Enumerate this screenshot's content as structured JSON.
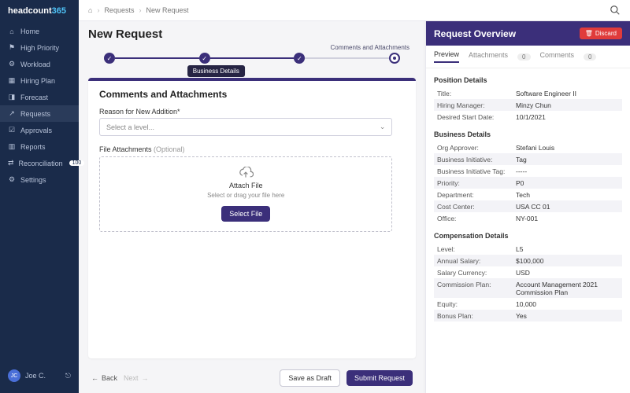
{
  "brand": {
    "a": "headcount",
    "b": "365"
  },
  "sidebar": {
    "items": [
      {
        "label": "Home"
      },
      {
        "label": "High Priority"
      },
      {
        "label": "Workload"
      },
      {
        "label": "Hiring Plan"
      },
      {
        "label": "Forecast"
      },
      {
        "label": "Requests"
      },
      {
        "label": "Approvals"
      },
      {
        "label": "Reports"
      },
      {
        "label": "Reconciliation",
        "badge": "100"
      },
      {
        "label": "Settings"
      }
    ],
    "user": {
      "initials": "JC",
      "name": "Joe C."
    }
  },
  "breadcrumbs": [
    "Requests",
    "New Request"
  ],
  "page_title": "New Request",
  "stepper": {
    "caption": "Comments and Attachments",
    "tooltip": "Business Details"
  },
  "card": {
    "title": "Comments and Attachments",
    "reason_label": "Reason for New Addition*",
    "select_placeholder": "Select a level...",
    "file_label": "File Attachments ",
    "file_optional": "(Optional)",
    "dz_title": "Attach File",
    "dz_sub": "Select or drag your file here",
    "select_file": "Select File"
  },
  "footer": {
    "back": "Back",
    "next": "Next",
    "draft": "Save as Draft",
    "submit": "Submit Request"
  },
  "panel": {
    "title": "Request Overview",
    "discard": "Discard",
    "tabs": {
      "preview": "Preview",
      "attachments": "Attachments",
      "a_count": "0",
      "comments": "Comments",
      "c_count": "0"
    },
    "sections": [
      {
        "title": "Position Details",
        "rows": [
          {
            "k": "Title:",
            "v": "Software Engineer II"
          },
          {
            "k": "Hiring Manager:",
            "v": "Minzy Chun"
          },
          {
            "k": "Desired Start Date:",
            "v": "10/1/2021"
          }
        ]
      },
      {
        "title": "Business Details",
        "rows": [
          {
            "k": "Org Approver:",
            "v": "Stefani Louis"
          },
          {
            "k": "Business Initiative:",
            "v": "Tag"
          },
          {
            "k": "Business Initiative Tag:",
            "v": "-----"
          },
          {
            "k": "Priority:",
            "v": "P0"
          },
          {
            "k": "Department:",
            "v": "Tech"
          },
          {
            "k": "Cost Center:",
            "v": "USA CC 01"
          },
          {
            "k": "Office:",
            "v": "NY-001"
          }
        ]
      },
      {
        "title": "Compensation Details",
        "rows": [
          {
            "k": "Level:",
            "v": "L5"
          },
          {
            "k": "Annual Salary:",
            "v": "$100,000"
          },
          {
            "k": "Salary Currency:",
            "v": "USD"
          },
          {
            "k": "Commission Plan:",
            "v": "Account Management 2021 Commission Plan"
          },
          {
            "k": "Equity:",
            "v": "10,000"
          },
          {
            "k": "Bonus Plan:",
            "v": "Yes"
          }
        ]
      }
    ]
  }
}
